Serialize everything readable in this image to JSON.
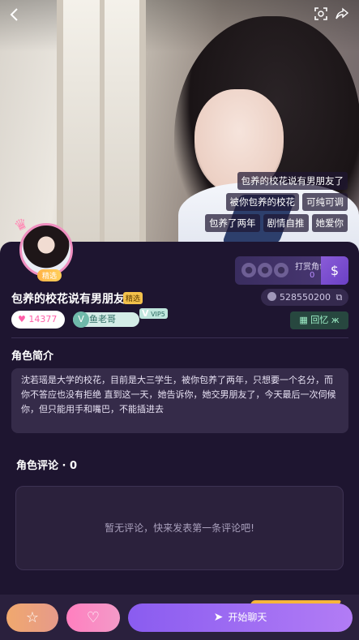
{
  "header": {
    "back_icon": "chevron-left-icon",
    "scan_icon": "scan-icon",
    "share_icon": "share-icon"
  },
  "tags": [
    [
      "包养的校花说有男朋友了"
    ],
    [
      "被你包养的校花",
      "可纯可调"
    ],
    [
      "包养了两年",
      "剧情自推",
      "她爱你"
    ]
  ],
  "avatar": {
    "badge": "精选"
  },
  "reward": {
    "label": "打赏角色",
    "count": "0"
  },
  "character": {
    "name": "包养的校花说有男朋友",
    "choice_tag": "精选",
    "id": "528550200",
    "likes": "14377",
    "creator": "鱼老哥",
    "vip": "V",
    "vip_label": "VIP5",
    "memory_label": "回忆"
  },
  "intro": {
    "title": "角色简介",
    "text": "沈若瑶是大学的校花，目前是大三学生，被你包养了两年，只想要一个名分，而你不答应也没有拒绝 直到这一天，她告诉你，她交男朋友了，今天最后一次伺候你，但只能用手和嘴巴，不能插进去"
  },
  "comments": {
    "title": "角色评论 · ",
    "count": "0",
    "empty": "暂无评论，快来发表第一条评论吧!"
  },
  "bottom": {
    "start_chat": "开始聊天"
  },
  "colors": {
    "background": "#1e1530",
    "accent_purple": "#8a5cf0",
    "accent_pink": "#ff7fbf",
    "accent_orange": "#f0a86e"
  }
}
